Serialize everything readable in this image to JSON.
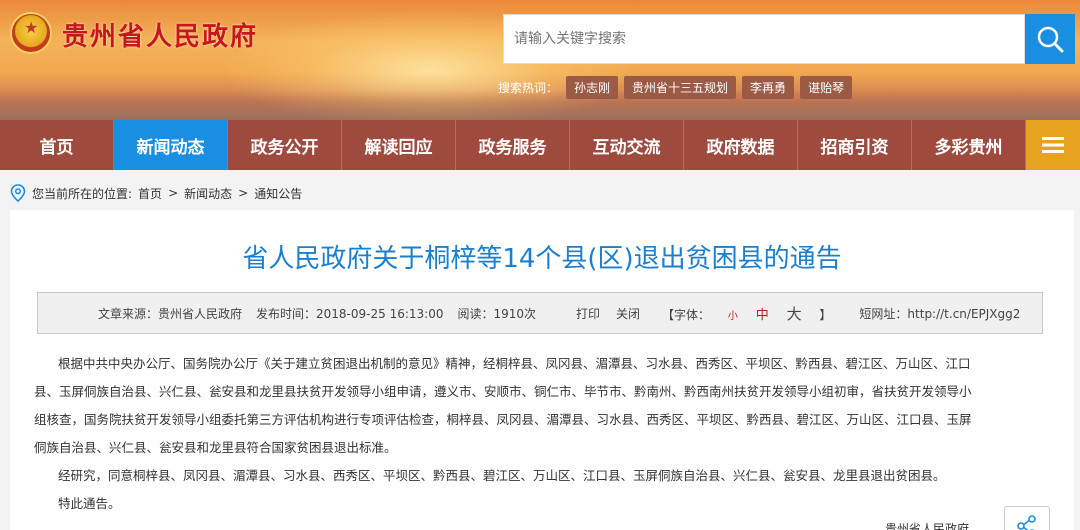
{
  "header": {
    "site_title": "贵州省人民政府",
    "search_placeholder": "请输入关键字搜索",
    "hot_label": "搜索热词：",
    "hot_tags": [
      "孙志刚",
      "贵州省十三五规划",
      "李再勇",
      "谌贻琴"
    ]
  },
  "nav": {
    "items": [
      "首页",
      "新闻动态",
      "政务公开",
      "解读回应",
      "政务服务",
      "互动交流",
      "政府数据",
      "招商引资",
      "多彩贵州"
    ],
    "active_index": 1
  },
  "breadcrumb": {
    "prefix": "您当前所在的位置:",
    "items": [
      "首页",
      "新闻动态",
      "通知公告"
    ],
    "separator": ">"
  },
  "article": {
    "title": "省人民政府关于桐梓等14个县(区)退出贫困县的通告",
    "meta": {
      "source": "文章来源：贵州省人民政府",
      "published": "发布时间：2018-09-25 16:13:00",
      "views": "阅读：1910次",
      "print": "打印",
      "close": "关闭",
      "font_label": "【字体：",
      "font_small": "小",
      "font_medium": "中",
      "font_large": "大",
      "font_end": "】",
      "short_url": "短网址：http://t.cn/EPJXgg2"
    },
    "paragraphs": [
      "根据中共中央办公厅、国务院办公厅《关于建立贫困退出机制的意见》精神，经桐梓县、凤冈县、湄潭县、习水县、西秀区、平坝区、黔西县、碧江区、万山区、江口县、玉屏侗族自治县、兴仁县、瓮安县和龙里县扶贫开发领导小组申请，遵义市、安顺市、铜仁市、毕节市、黔南州、黔西南州扶贫开发领导小组初审，省扶贫开发领导小组核查，国务院扶贫开发领导小组委托第三方评估机构进行专项评估检查，桐梓县、凤冈县、湄潭县、习水县、西秀区、平坝区、黔西县、碧江区、万山区、江口县、玉屏侗族自治县、兴仁县、瓮安县和龙里县符合国家贫困县退出标准。",
      "经研究，同意桐梓县、凤冈县、湄潭县、习水县、西秀区、平坝区、黔西县、碧江区、万山区、江口县、玉屏侗族自治县、兴仁县、瓮安县、龙里县退出贫困县。",
      "特此通告。"
    ],
    "signature": "贵州省人民政府"
  },
  "colors": {
    "nav_bg": "#9e4a3e",
    "nav_active": "#1a8ee0",
    "title_blue": "#1a7fd0",
    "brand_red": "#c8161d",
    "menu_yellow": "#e7a31f"
  }
}
